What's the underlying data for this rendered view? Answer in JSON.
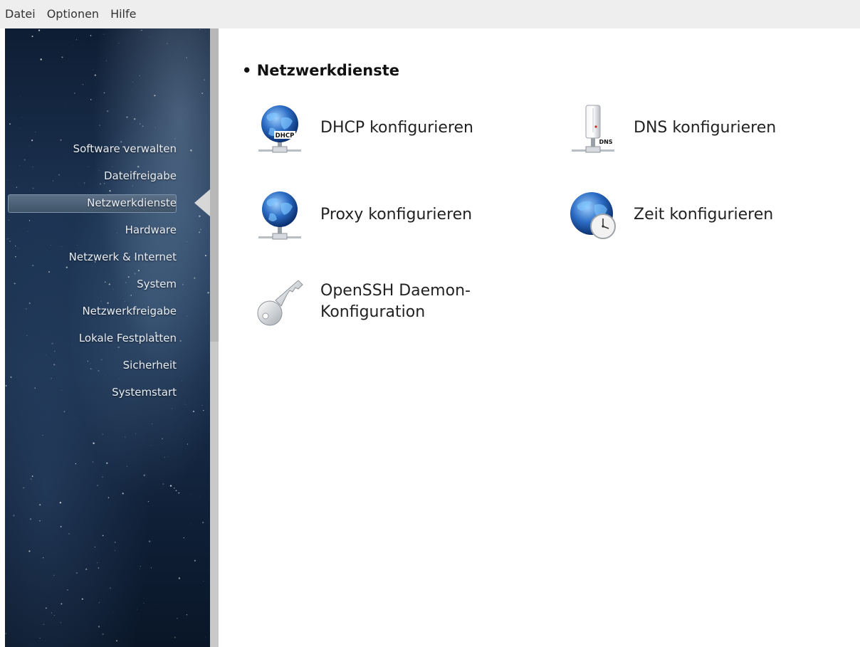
{
  "menubar": {
    "items": [
      "Datei",
      "Optionen",
      "Hilfe"
    ]
  },
  "sidebar": {
    "items": [
      {
        "label": "Software verwalten"
      },
      {
        "label": "Dateifreigabe"
      },
      {
        "label": "Netzwerkdienste",
        "active": true
      },
      {
        "label": "Hardware"
      },
      {
        "label": "Netzwerk & Internet"
      },
      {
        "label": "System"
      },
      {
        "label": "Netzwerkfreigabe"
      },
      {
        "label": "Lokale Festplatten"
      },
      {
        "label": "Sicherheit"
      },
      {
        "label": "Systemstart"
      }
    ]
  },
  "main": {
    "section_title": "• Netzwerkdienste",
    "tools": [
      {
        "label": "DHCP konfigurieren",
        "icon": "dhcp-globe-icon",
        "badge": "DHCP"
      },
      {
        "label": "DNS konfigurieren",
        "icon": "dns-server-icon",
        "badge": "DNS"
      },
      {
        "label": "Proxy konfigurieren",
        "icon": "proxy-globe-icon"
      },
      {
        "label": "Zeit konfigurieren",
        "icon": "globe-clock-icon"
      },
      {
        "label": "OpenSSH Daemon-\nKonfiguration",
        "icon": "key-icon"
      }
    ]
  },
  "colors": {
    "selection": "#4a5e75",
    "menubar": "#eeeeee",
    "globe": "#2b6cc4"
  }
}
